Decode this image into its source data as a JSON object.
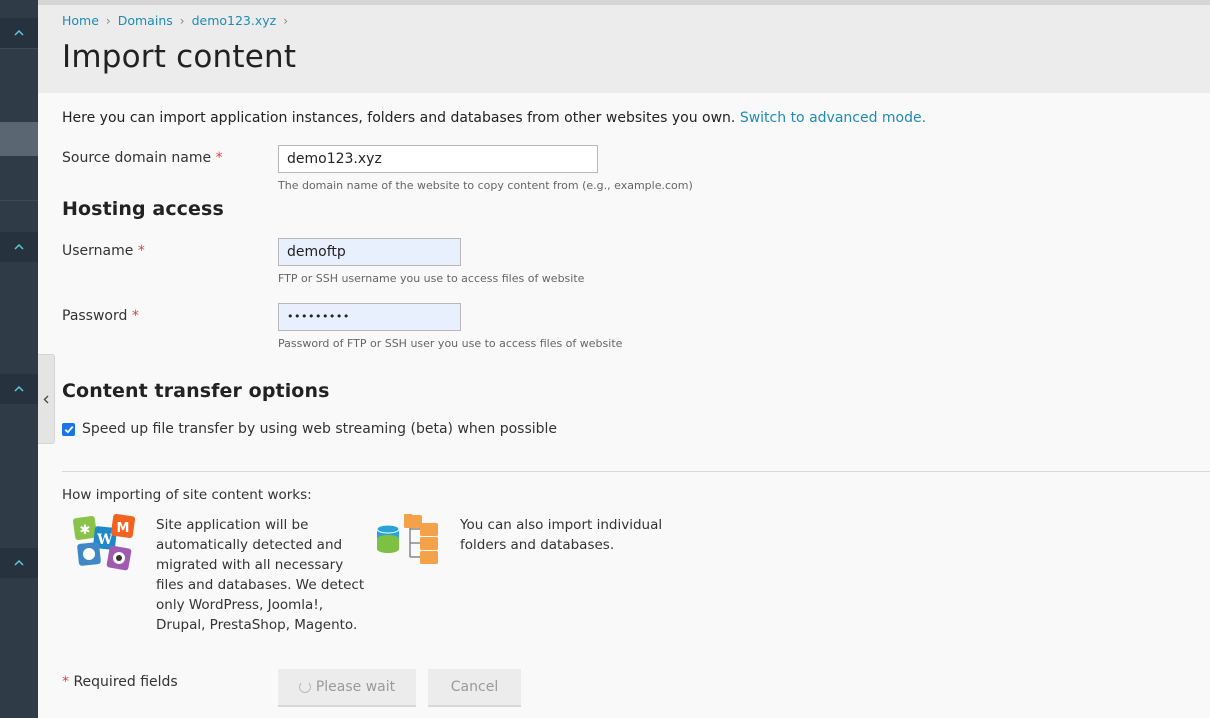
{
  "breadcrumb": {
    "items": [
      "Home",
      "Domains",
      "demo123.xyz"
    ]
  },
  "page": {
    "title": "Import content"
  },
  "intro": {
    "text": "Here you can import application instances, folders and databases from other websites you own.",
    "advanced_link": "Switch to advanced mode."
  },
  "source": {
    "label": "Source domain name",
    "required_mark": "*",
    "value": "demo123.xyz",
    "hint": "The domain name of the website to copy content from (e.g., example.com)"
  },
  "hosting": {
    "heading": "Hosting access",
    "username": {
      "label": "Username",
      "required_mark": "*",
      "value": "demoftp",
      "hint": "FTP or SSH username you use to access files of website"
    },
    "password": {
      "label": "Password",
      "required_mark": "*",
      "masked_value": "•••••••••",
      "hint": "Password of FTP or SSH user you use to access files of website"
    }
  },
  "transfer": {
    "heading": "Content transfer options",
    "streaming_label": "Speed up file transfer by using web streaming (beta) when possible",
    "streaming_checked": true
  },
  "how": {
    "title": "How importing of site content works:",
    "apps_text": "Site application will be automatically detected and migrated with all necessary files and databases. We detect only WordPress, Joomla!, Drupal, PrestaShop, Magento.",
    "apps_icon": "cms-apps-icon",
    "folders_text": "You can also import individual folders and databases.",
    "folders_icon": "folders-databases-icon"
  },
  "footer": {
    "required_mark": "*",
    "required_text": "Required fields",
    "submit_label": "Please wait",
    "cancel_label": "Cancel"
  },
  "colors": {
    "rail": "#2f3c48",
    "link": "#1f8bb5",
    "accent": "#5fc7dd",
    "required": "#d44444",
    "checkbox": "#1a73e8"
  }
}
